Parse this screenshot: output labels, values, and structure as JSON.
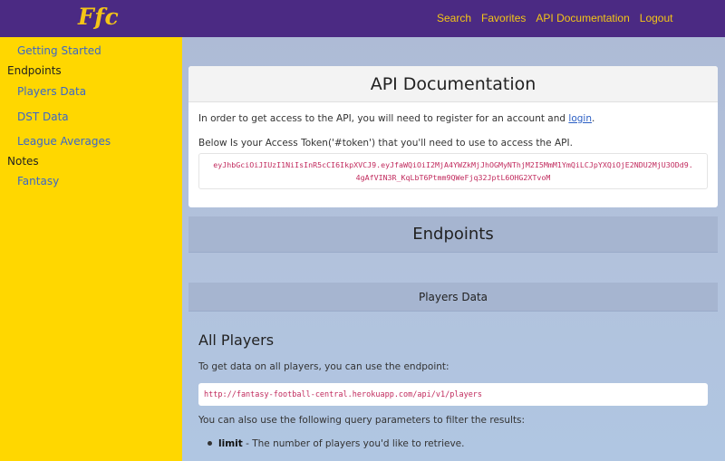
{
  "nav": {
    "logo": "Ffc",
    "links": [
      "Search",
      "Favorites",
      "API Documentation",
      "Logout"
    ]
  },
  "sidebar": {
    "items": [
      {
        "label": "Getting Started",
        "type": "link"
      },
      {
        "label": "Endpoints",
        "type": "heading"
      },
      {
        "label": "Players Data",
        "type": "link"
      },
      {
        "label": "DST Data",
        "type": "link"
      },
      {
        "label": "League Averages",
        "type": "link"
      },
      {
        "label": "Notes",
        "type": "heading"
      },
      {
        "label": "Fantasy",
        "type": "link"
      }
    ]
  },
  "card": {
    "title": "API Documentation",
    "intro_text": "In order to get access to the API, you will need to register for an account and",
    "login_link": "login",
    "intro_suffix": ".",
    "token_text": "Below Is your Access Token('#token') that you'll need to use to access the API.",
    "token_line1": "eyJhbGciOiJIUzI1NiIsInR5cCI6IkpXVCJ9.eyJfaWQiOiI2MjA4YWZkMjJhOGMyNThjM2I5MmM1YmQiLCJpYXQiOjE2NDU2MjU3ODd9.",
    "token_line2": "4gAfVIN3R_KqLbT6Ptmm9QWeFjq32JptL6OHG2XTvoM"
  },
  "main": {
    "endpoints_heading": "Endpoints",
    "players_data_heading": "Players Data",
    "all_players_heading": "All Players",
    "all_players_text": "To get data on all players, you can use the endpoint:",
    "endpoint_url": "http://fantasy-football-central.herokuapp.com/api/v1/players",
    "query_text": "You can also use the following query parameters to filter the results:",
    "param_name": "limit",
    "param_desc": " - The number of players you'd like to retrieve."
  }
}
